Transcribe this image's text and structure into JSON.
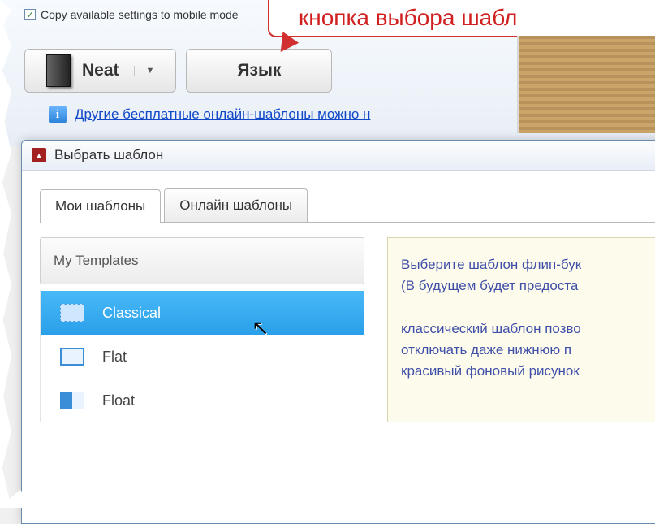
{
  "top": {
    "copy_checkbox_label": "Copy available settings to mobile mode",
    "callout_text": "кнопка выбора шабл",
    "neat_button": "Neat",
    "lang_button": "Язык",
    "link_text": "Другие бесплатные онлайн-шаблоны можно н"
  },
  "dialog": {
    "title": "Выбрать шаблон",
    "tabs": [
      {
        "label": "Мои шаблоны",
        "active": true
      },
      {
        "label": "Онлайн шаблоны",
        "active": false
      }
    ],
    "tree_header": "My Templates",
    "templates": [
      {
        "name": "Classical",
        "selected": true
      },
      {
        "name": "Flat",
        "selected": false
      },
      {
        "name": "Float",
        "selected": false
      }
    ],
    "desc_line1": "Выберите шаблон флип-бук",
    "desc_line2": "(В будущем будет предоста",
    "desc_line3": "классический шаблон позво",
    "desc_line4": "отключать даже нижнюю п",
    "desc_line5": "красивый фоновый рисунок"
  }
}
